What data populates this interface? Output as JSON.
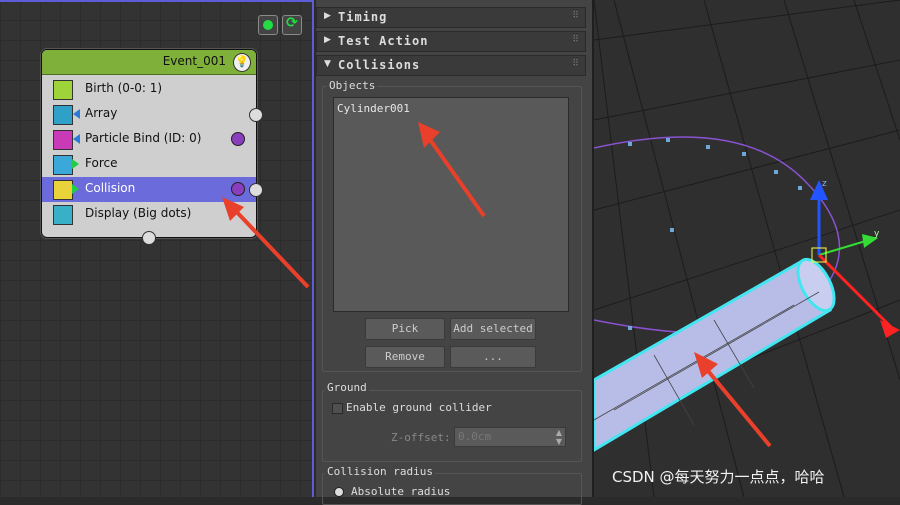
{
  "graph": {
    "event_title": "Event_001",
    "operators": [
      {
        "label": "Birth (0-0: 1)",
        "icon": "birth-icon",
        "color": "#9fd33a"
      },
      {
        "label": "Array",
        "icon": "array-icon",
        "color": "#3aa8d8"
      },
      {
        "label": "Particle Bind (ID: 0)",
        "icon": "particle-bind-icon",
        "color": "#c83ab6"
      },
      {
        "label": "Force",
        "icon": "force-icon",
        "color": "#3aa8d8"
      },
      {
        "label": "Collision",
        "icon": "collision-icon",
        "color": "#e8d43a"
      },
      {
        "label": "Display (Big dots)",
        "icon": "display-icon",
        "color": "#3ab0c8"
      }
    ],
    "selected": "Collision"
  },
  "panel": {
    "rollouts": {
      "timing": "Timing",
      "test_action": "Test Action",
      "collisions": "Collisions"
    },
    "objects_label": "Objects",
    "objects": [
      "Cylinder001"
    ],
    "buttons": {
      "pick": "Pick",
      "add_selected": "Add selected",
      "remove": "Remove",
      "more": "..."
    },
    "ground_label": "Ground",
    "ground_checkbox": "Enable ground collider",
    "z_offset_label": "Z-offset:",
    "z_offset_value": "0.0cm",
    "collision_radius_label": "Collision radius",
    "absolute_radius": "Absolute radius"
  },
  "watermark": "CSDN @每天努力一点点，哈哈",
  "colors": {
    "accent": "#6b6bdc",
    "event_header": "#7fb13a",
    "arrow": "#e8402a",
    "cylinder": "#b8bde8",
    "selection": "#42e6f0"
  }
}
